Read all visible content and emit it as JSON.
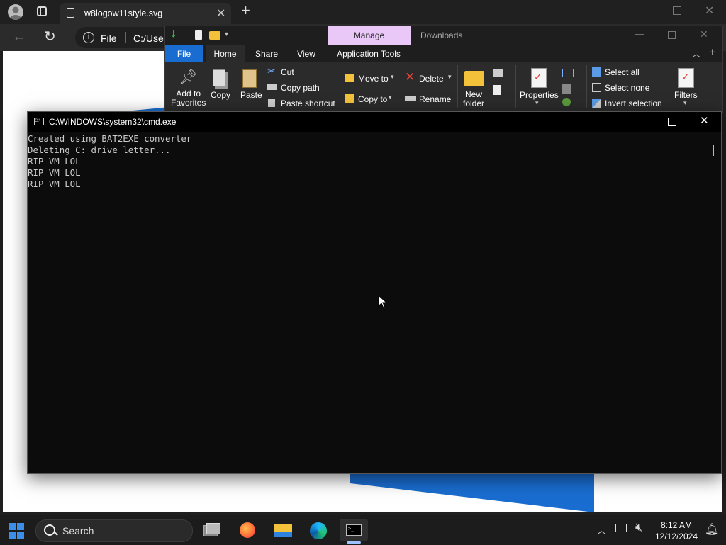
{
  "browser": {
    "tab_title": "w8logow11style.svg",
    "address_prefix": "File",
    "address_path": "C:/User"
  },
  "explorer": {
    "manage_label": "Manage",
    "window_title": "Downloads",
    "tabs": [
      "File",
      "Home",
      "Share",
      "View",
      "Application Tools"
    ],
    "ribbon": {
      "add_to_favorites": "Add to\nFavorites",
      "copy": "Copy",
      "paste": "Paste",
      "cut": "Cut",
      "copy_path": "Copy path",
      "paste_shortcut": "Paste shortcut",
      "move_to": "Move to",
      "copy_to": "Copy to",
      "delete": "Delete",
      "rename": "Rename",
      "new_folder": "New\nfolder",
      "properties": "Properties",
      "select_all": "Select all",
      "select_none": "Select none",
      "invert_selection": "Invert selection",
      "filters": "Filters"
    }
  },
  "cmd": {
    "title": "C:\\WINDOWS\\system32\\cmd.exe",
    "output": "Created using BAT2EXE converter\nDeleting C: drive letter...\nRIP VM LOL\nRIP VM LOL\nRIP VM LOL"
  },
  "taskbar": {
    "search_label": "Search",
    "time": "8:12 AM",
    "date": "12/12/2024"
  },
  "colors": {
    "accent_blue": "#1a6dd0",
    "manage_tab": "#e9c8f8",
    "cmd_text": "#cccccc"
  }
}
